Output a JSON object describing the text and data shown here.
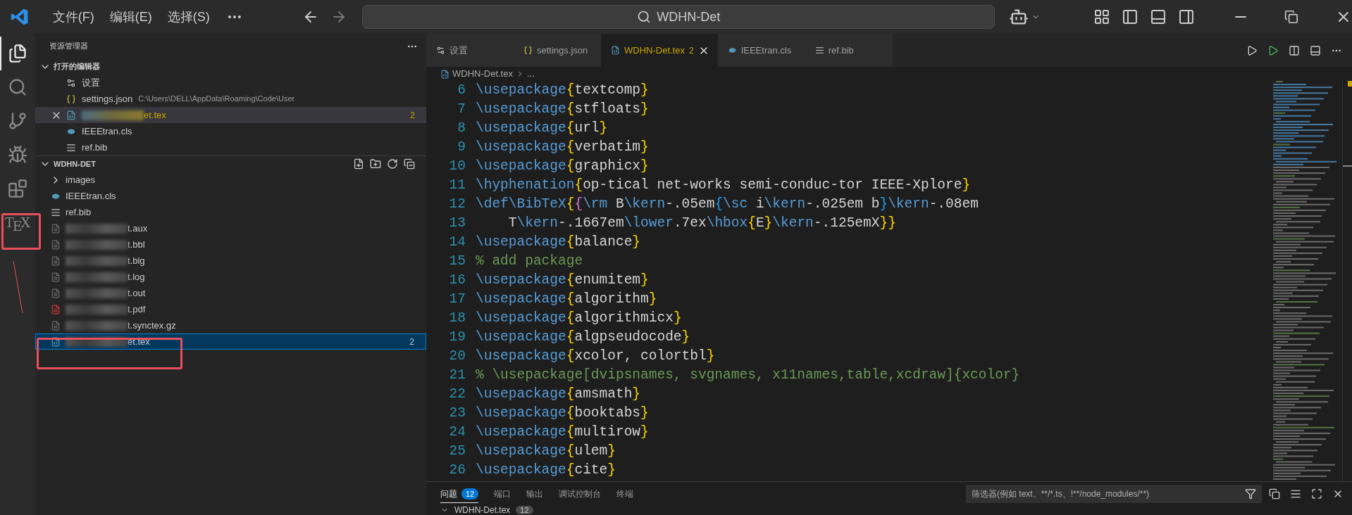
{
  "title_bar": {
    "menus": [
      "文件(F)",
      "编辑(E)",
      "选择(S)"
    ],
    "search": "WDHN-Det"
  },
  "activity_bar": [
    {
      "kind": "explorer",
      "selected": true
    },
    {
      "kind": "search",
      "selected": false
    },
    {
      "kind": "source-control",
      "selected": false
    },
    {
      "kind": "run",
      "selected": false
    },
    {
      "kind": "extensions",
      "selected": false
    },
    {
      "kind": "tex",
      "label": "TEX",
      "selected": false
    }
  ],
  "sidebar": {
    "title": "资源管理器",
    "open_editors": {
      "title": "打开的编辑器",
      "expanded": true,
      "items": [
        {
          "kind": "settings",
          "name": "设置",
          "selected": false,
          "warning": false,
          "redacted": false
        },
        {
          "kind": "json",
          "name": "settings.json",
          "path": "C:\\Users\\DELL\\AppData\\Roaming\\Code\\User",
          "selected": false,
          "warning": false,
          "redacted": false
        },
        {
          "kind": "tex",
          "name": "et.tex",
          "badge": "2",
          "selected": true,
          "warning": true,
          "redacted": true
        },
        {
          "kind": "cls",
          "name": "IEEEtran.cls",
          "selected": false,
          "warning": false,
          "redacted": false
        },
        {
          "kind": "bib",
          "name": "ref.bib",
          "selected": false,
          "warning": false,
          "redacted": false
        }
      ]
    },
    "folder": {
      "title": "WDHN-DET",
      "expanded": true,
      "items": [
        {
          "kind": "folder",
          "name": "images",
          "expanded": false,
          "selected": false,
          "redacted": false
        },
        {
          "kind": "cls",
          "name": "IEEEtran.cls",
          "selected": false,
          "redacted": false
        },
        {
          "kind": "bib",
          "name": "ref.bib",
          "selected": false,
          "redacted": false
        },
        {
          "kind": "file",
          "name": "t.aux",
          "selected": false,
          "redacted": true
        },
        {
          "kind": "file",
          "name": "t.bbl",
          "selected": false,
          "redacted": true
        },
        {
          "kind": "file",
          "name": "t.blg",
          "selected": false,
          "redacted": true
        },
        {
          "kind": "file",
          "name": "t.log",
          "selected": false,
          "redacted": true
        },
        {
          "kind": "file",
          "name": "t.out",
          "selected": false,
          "redacted": true
        },
        {
          "kind": "pdf",
          "name": "t.pdf",
          "selected": false,
          "redacted": true
        },
        {
          "kind": "file",
          "name": "t.synctex.gz",
          "selected": false,
          "redacted": true
        },
        {
          "kind": "tex",
          "name": "et.tex",
          "badge": "2",
          "selected": true,
          "redacted": true
        }
      ]
    }
  },
  "tabs": [
    {
      "kind": "settings",
      "label": "设置",
      "selected": false
    },
    {
      "kind": "json",
      "label": "settings.json",
      "selected": false
    },
    {
      "kind": "tex",
      "label": "WDHN-Det.tex",
      "badge": "2",
      "selected": true
    },
    {
      "kind": "cls",
      "label": "IEEEtran.cls",
      "selected": false
    },
    {
      "kind": "bib",
      "label": "ref.bib",
      "selected": false
    }
  ],
  "breadcrumb": [
    "WDHN-Det.tex",
    "..."
  ],
  "code": [
    {
      "number": "6",
      "text": "\\usepackage{textcomp}"
    },
    {
      "number": "7",
      "text": "\\usepackage{stfloats}"
    },
    {
      "number": "8",
      "text": "\\usepackage{url}"
    },
    {
      "number": "9",
      "text": "\\usepackage{verbatim}"
    },
    {
      "number": "10",
      "text": "\\usepackage{graphicx}"
    },
    {
      "number": "11",
      "text": "\\hyphenation{op-tical net-works semi-conduc-tor IEEE-Xplore}"
    },
    {
      "number": "12",
      "text": "\\def\\BibTeX{{\\rm B\\kern-.05em{\\sc i\\kern-.025em b}\\kern-.08em"
    },
    {
      "number": "13",
      "text": "    T\\kern-.1667em\\lower.7ex\\hbox{E}\\kern-.125emX}}"
    },
    {
      "number": "14",
      "text": "\\usepackage{balance}"
    },
    {
      "number": "15",
      "text": "% add package"
    },
    {
      "number": "16",
      "text": "\\usepackage{enumitem}"
    },
    {
      "number": "17",
      "text": "\\usepackage{algorithm}"
    },
    {
      "number": "18",
      "text": "\\usepackage{algorithmicx}"
    },
    {
      "number": "19",
      "text": "\\usepackage{algpseudocode}"
    },
    {
      "number": "20",
      "text": "\\usepackage{xcolor, colortbl}"
    },
    {
      "number": "21",
      "text": "% \\usepackage[dvipsnames, svgnames, x11names,table,xcdraw]{xcolor}"
    },
    {
      "number": "22",
      "text": "\\usepackage{amsmath}"
    },
    {
      "number": "23",
      "text": "\\usepackage{booktabs}"
    },
    {
      "number": "24",
      "text": "\\usepackage{multirow}"
    },
    {
      "number": "25",
      "text": "\\usepackage{ulem}"
    },
    {
      "number": "26",
      "text": "\\usepackage{cite}"
    }
  ],
  "panel": {
    "tabs": [
      {
        "label": "问题",
        "badge": "12",
        "selected": true
      },
      {
        "label": "端口",
        "selected": false
      },
      {
        "label": "输出",
        "selected": false
      },
      {
        "label": "调试控制台",
        "selected": false
      },
      {
        "label": "终端",
        "selected": false
      }
    ],
    "filter": {
      "placeholder": "筛选器(例如 text、**/*.ts、!**/node_modules/**)"
    },
    "problem_file": {
      "name": "WDHN-Det.tex",
      "count": "12",
      "expanded": true
    }
  }
}
